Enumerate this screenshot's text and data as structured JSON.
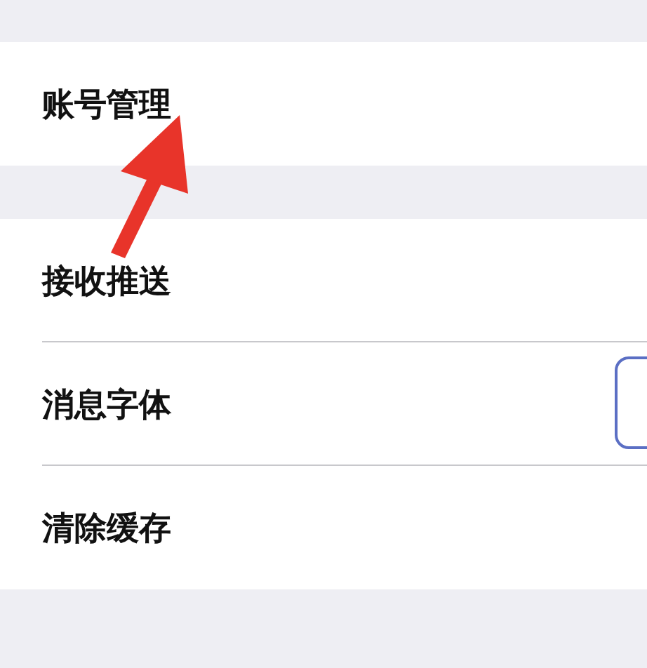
{
  "sections": [
    {
      "rows": [
        {
          "label": "账号管理",
          "kind": "plain"
        }
      ]
    },
    {
      "rows": [
        {
          "label": "接收推送",
          "kind": "plain"
        },
        {
          "label": "消息字体",
          "kind": "control"
        },
        {
          "label": "清除缓存",
          "kind": "plain"
        }
      ]
    }
  ],
  "annotation": {
    "kind": "arrow"
  }
}
